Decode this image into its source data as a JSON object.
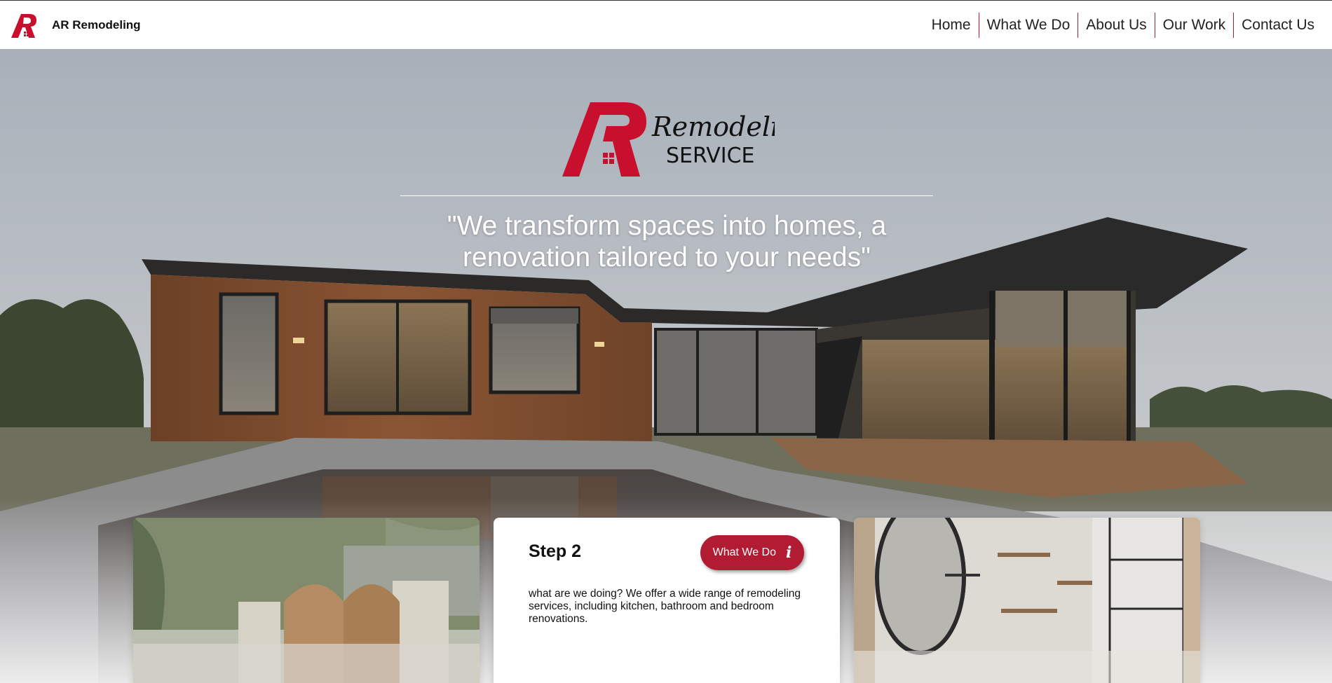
{
  "brand": {
    "name": "AR Remodeling",
    "logo_icon": "ar-house-logo-icon",
    "accent_color": "#b21c33"
  },
  "nav": {
    "links": [
      {
        "label": "Home"
      },
      {
        "label": "What We Do"
      },
      {
        "label": "About Us"
      },
      {
        "label": "Our Work"
      },
      {
        "label": "Contact Us"
      }
    ]
  },
  "hero": {
    "logo": {
      "script_word": "Remodeling",
      "word": "SERVICE"
    },
    "quote": "\"We transform spaces into homes, a renovation tailored to your needs\""
  },
  "step_card": {
    "title": "Step 2",
    "button_label": "What We Do",
    "button_icon": "info-icon",
    "text": "what are we doing? We offer a wide range of remodeling services, including kitchen, bathroom and bedroom renovations."
  }
}
